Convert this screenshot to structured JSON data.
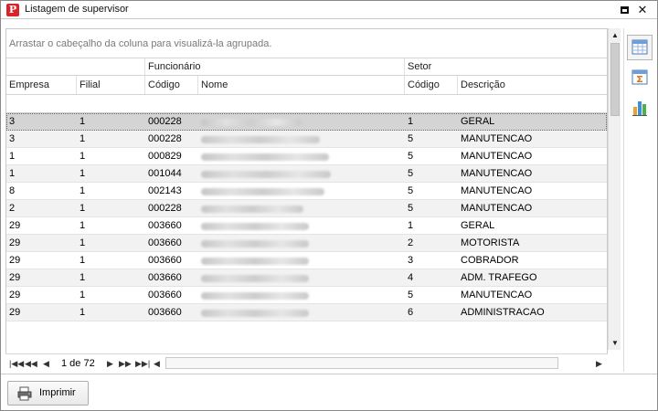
{
  "window": {
    "title": "Listagem de supervisor"
  },
  "group_panel": {
    "hint": "Arrastar o cabeçalho da coluna para visualizá-la agrupada."
  },
  "bands": {
    "funcionario": "Funcionário",
    "setor": "Setor"
  },
  "columns": {
    "empresa": "Empresa",
    "filial": "Filial",
    "func_codigo": "Código",
    "nome": "Nome",
    "setor_codigo": "Código",
    "descricao": "Descrição"
  },
  "rows": [
    {
      "empresa": "3",
      "filial": "1",
      "codigo": "000228",
      "setor": "1",
      "descricao": "GERAL"
    },
    {
      "empresa": "3",
      "filial": "1",
      "codigo": "000228",
      "setor": "5",
      "descricao": "MANUTENCAO"
    },
    {
      "empresa": "1",
      "filial": "1",
      "codigo": "000829",
      "setor": "5",
      "descricao": "MANUTENCAO"
    },
    {
      "empresa": "1",
      "filial": "1",
      "codigo": "001044",
      "setor": "5",
      "descricao": "MANUTENCAO"
    },
    {
      "empresa": "8",
      "filial": "1",
      "codigo": "002143",
      "setor": "5",
      "descricao": "MANUTENCAO"
    },
    {
      "empresa": "2",
      "filial": "1",
      "codigo": "000228",
      "setor": "5",
      "descricao": "MANUTENCAO"
    },
    {
      "empresa": "29",
      "filial": "1",
      "codigo": "003660",
      "setor": "1",
      "descricao": "GERAL"
    },
    {
      "empresa": "29",
      "filial": "1",
      "codigo": "003660",
      "setor": "2",
      "descricao": "MOTORISTA"
    },
    {
      "empresa": "29",
      "filial": "1",
      "codigo": "003660",
      "setor": "3",
      "descricao": "COBRADOR"
    },
    {
      "empresa": "29",
      "filial": "1",
      "codigo": "003660",
      "setor": "4",
      "descricao": "ADM. TRAFEGO"
    },
    {
      "empresa": "29",
      "filial": "1",
      "codigo": "003660",
      "setor": "5",
      "descricao": "MANUTENCAO"
    },
    {
      "empresa": "29",
      "filial": "1",
      "codigo": "003660",
      "setor": "6",
      "descricao": "ADMINISTRACAO"
    }
  ],
  "pager": {
    "page_text": "1 de 72"
  },
  "footer": {
    "print_label": "Imprimir"
  }
}
